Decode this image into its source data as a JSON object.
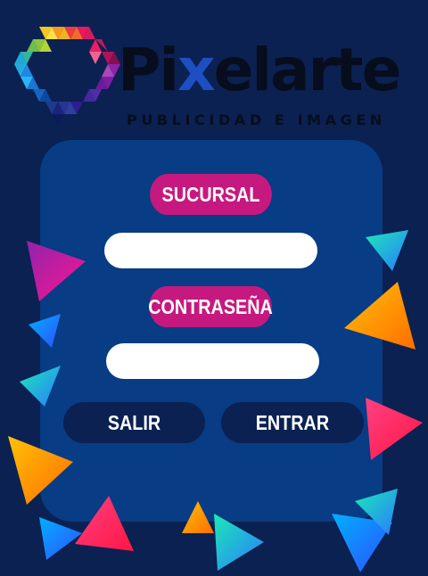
{
  "brand": {
    "name_prefix": "Pi",
    "name_x": "x",
    "name_suffix": "elarte",
    "tagline": "PUBLICIDAD E IMAGEN"
  },
  "form": {
    "sucursal_label": "SUCURSAL",
    "sucursal_value": "",
    "password_label": "CONTRASEÑA",
    "password_value": "",
    "exit_label": "SALIR",
    "enter_label": "ENTRAR"
  },
  "colors": {
    "background": "#0b2152",
    "panel": "#083c84",
    "label_pill": "#c6197f",
    "button": "#0b2152"
  }
}
